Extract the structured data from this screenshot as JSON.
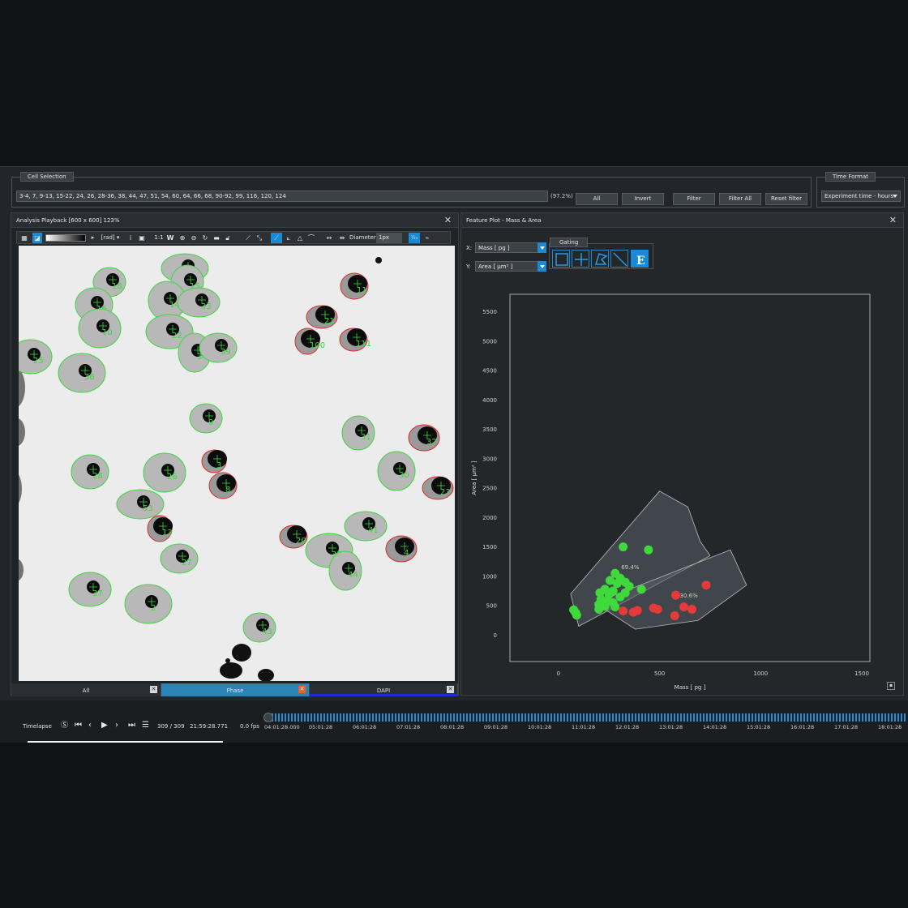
{
  "cell_selection": {
    "title": "Cell Selection",
    "value": "3-4, 7, 9-13, 15-22, 24, 26, 28-36, 38, 44, 47, 51, 54, 60, 64, 66, 68, 90-92, 99, 116, 120, 124",
    "percent": "(97.2%)",
    "buttons": [
      "All",
      "Invert",
      "Filter",
      "Filter All",
      "Reset filter"
    ]
  },
  "time_format": {
    "title": "Time Format",
    "value": "Experiment time - hours"
  },
  "analysis_panel": {
    "title": "Analysis Playback [600 x 600] 123%",
    "unit_select": "[rad]",
    "zoom_ratio": "1:1",
    "w_label": "W",
    "diameter_label": "Diameter:",
    "diameter_value": "1px",
    "tabs": [
      {
        "label": "All"
      },
      {
        "label": "Phase"
      },
      {
        "label": "DAPI"
      }
    ],
    "cells": [
      {
        "id": "18",
        "x": 112,
        "y": 45,
        "c": "g"
      },
      {
        "id": "16",
        "x": 93,
        "y": 73,
        "c": "g"
      },
      {
        "id": "10",
        "x": 100,
        "y": 102,
        "c": "g"
      },
      {
        "id": "12",
        "x": 205,
        "y": 28,
        "c": "g"
      },
      {
        "id": "15",
        "x": 208,
        "y": 45,
        "c": "g"
      },
      {
        "id": "14",
        "x": 183,
        "y": 68,
        "c": "g"
      },
      {
        "id": "33",
        "x": 222,
        "y": 70,
        "c": "g"
      },
      {
        "id": "22",
        "x": 186,
        "y": 106,
        "c": "g"
      },
      {
        "id": "34",
        "x": 217,
        "y": 132,
        "c": "g"
      },
      {
        "id": "39",
        "x": 246,
        "y": 126,
        "c": "g"
      },
      {
        "id": "25",
        "x": 15,
        "y": 137,
        "c": "g"
      },
      {
        "id": "36",
        "x": 78,
        "y": 157,
        "c": "g"
      },
      {
        "id": "9",
        "x": 231,
        "y": 213,
        "c": "g"
      },
      {
        "id": "28",
        "x": 88,
        "y": 279,
        "c": "g"
      },
      {
        "id": "26",
        "x": 180,
        "y": 280,
        "c": "g"
      },
      {
        "id": "53",
        "x": 150,
        "y": 319,
        "c": "g"
      },
      {
        "id": "31",
        "x": 419,
        "y": 231,
        "c": "g"
      },
      {
        "id": "30",
        "x": 466,
        "y": 278,
        "c": "g"
      },
      {
        "id": "41",
        "x": 428,
        "y": 346,
        "c": "g"
      },
      {
        "id": "35",
        "x": 383,
        "y": 376,
        "c": "g"
      },
      {
        "id": "44",
        "x": 403,
        "y": 401,
        "c": "g"
      },
      {
        "id": "27",
        "x": 198,
        "y": 386,
        "c": "g"
      },
      {
        "id": "37",
        "x": 88,
        "y": 424,
        "c": "g"
      },
      {
        "id": "2",
        "x": 160,
        "y": 442,
        "c": "g"
      },
      {
        "id": "43",
        "x": 297,
        "y": 471,
        "c": "g"
      },
      {
        "id": "11",
        "x": 414,
        "y": 50,
        "c": "r"
      },
      {
        "id": "21",
        "x": 374,
        "y": 88,
        "c": "r"
      },
      {
        "id": "100",
        "x": 356,
        "y": 118,
        "c": "r"
      },
      {
        "id": "111",
        "x": 413,
        "y": 116,
        "c": "r"
      },
      {
        "id": "32",
        "x": 500,
        "y": 237,
        "c": "r"
      },
      {
        "id": "3",
        "x": 241,
        "y": 266,
        "c": "r"
      },
      {
        "id": "8",
        "x": 252,
        "y": 296,
        "c": "r"
      },
      {
        "id": "23",
        "x": 517,
        "y": 299,
        "c": "r"
      },
      {
        "id": "13",
        "x": 174,
        "y": 349,
        "c": "r"
      },
      {
        "id": "20",
        "x": 339,
        "y": 359,
        "c": "r"
      },
      {
        "id": "4",
        "x": 472,
        "y": 374,
        "c": "r"
      }
    ]
  },
  "feature_plot": {
    "title": "Feature Plot - Mass & Area",
    "x_label": "X:",
    "y_label": "Y:",
    "x_select": "Mass [ pg ]",
    "y_select": "Area [ μm² ]",
    "gating_title": "Gating",
    "gating_tools": [
      "rectangle-gate-icon",
      "quadrant-gate-icon",
      "polygon-gate-icon",
      "line-gate-icon",
      "ellipse-gate-icon"
    ],
    "gate_labels": [
      "69.4%",
      "30.6%"
    ]
  },
  "chart_data": {
    "type": "scatter",
    "xlabel": "Mass [ pg ]",
    "ylabel": "Area [ μm² ]",
    "xlim": [
      -240,
      1540
    ],
    "ylim": [
      -450,
      5800
    ],
    "x_ticks": [
      "0",
      "500",
      "1000",
      "1500"
    ],
    "y_ticks": [
      "0",
      "500",
      "1000",
      "1500",
      "2000",
      "2500",
      "3000",
      "3500",
      "4000",
      "4500",
      "5000",
      "5500"
    ],
    "gate_polygons": [
      {
        "label": "69.4%",
        "points": [
          [
            60,
            700
          ],
          [
            500,
            2450
          ],
          [
            640,
            2180
          ],
          [
            700,
            1600
          ],
          [
            750,
            1350
          ],
          [
            100,
            150
          ]
        ],
        "color": "#5b6168"
      },
      {
        "label": "30.6%",
        "points": [
          [
            180,
            550
          ],
          [
            850,
            1450
          ],
          [
            930,
            850
          ],
          [
            690,
            250
          ],
          [
            380,
            100
          ]
        ],
        "color": "#5b6168"
      }
    ],
    "series": [
      {
        "color": "#3ed93b",
        "points": [
          [
            320,
            1500
          ],
          [
            445,
            1450
          ],
          [
            280,
            1050
          ],
          [
            305,
            970
          ],
          [
            255,
            930
          ],
          [
            330,
            900
          ],
          [
            290,
            880
          ],
          [
            350,
            830
          ],
          [
            410,
            780
          ],
          [
            230,
            780
          ],
          [
            270,
            750
          ],
          [
            330,
            720
          ],
          [
            205,
            720
          ],
          [
            250,
            690
          ],
          [
            305,
            650
          ],
          [
            210,
            610
          ],
          [
            240,
            580
          ],
          [
            270,
            550
          ],
          [
            200,
            520
          ],
          [
            230,
            490
          ],
          [
            280,
            480
          ],
          [
            75,
            430
          ],
          [
            85,
            380
          ],
          [
            200,
            440
          ],
          [
            90,
            340
          ]
        ]
      },
      {
        "color": "#e43a3a",
        "points": [
          [
            730,
            850
          ],
          [
            580,
            680
          ],
          [
            470,
            460
          ],
          [
            490,
            440
          ],
          [
            390,
            420
          ],
          [
            370,
            390
          ],
          [
            320,
            410
          ],
          [
            620,
            480
          ],
          [
            660,
            440
          ],
          [
            575,
            330
          ]
        ]
      }
    ]
  },
  "timelapse": {
    "label": "Timelapse",
    "frame": "309 / 309",
    "time": "21:59:28.771",
    "fps": "0.0 fps",
    "ticks": [
      "04:01:28.000",
      "05:01:28",
      "06:01:28",
      "07:01:28",
      "08:01:28",
      "09:01:28",
      "10:01:28",
      "11:01:28",
      "12:01:28",
      "13:01:28",
      "14:01:28",
      "15:01:28",
      "16:01:28",
      "17:01:28",
      "18:01:28"
    ]
  },
  "colors": {
    "accent": "#1a8ad4",
    "gated_green": "#3ed93b",
    "gated_red": "#e43a3a",
    "tab_active": "#2a84b8"
  }
}
